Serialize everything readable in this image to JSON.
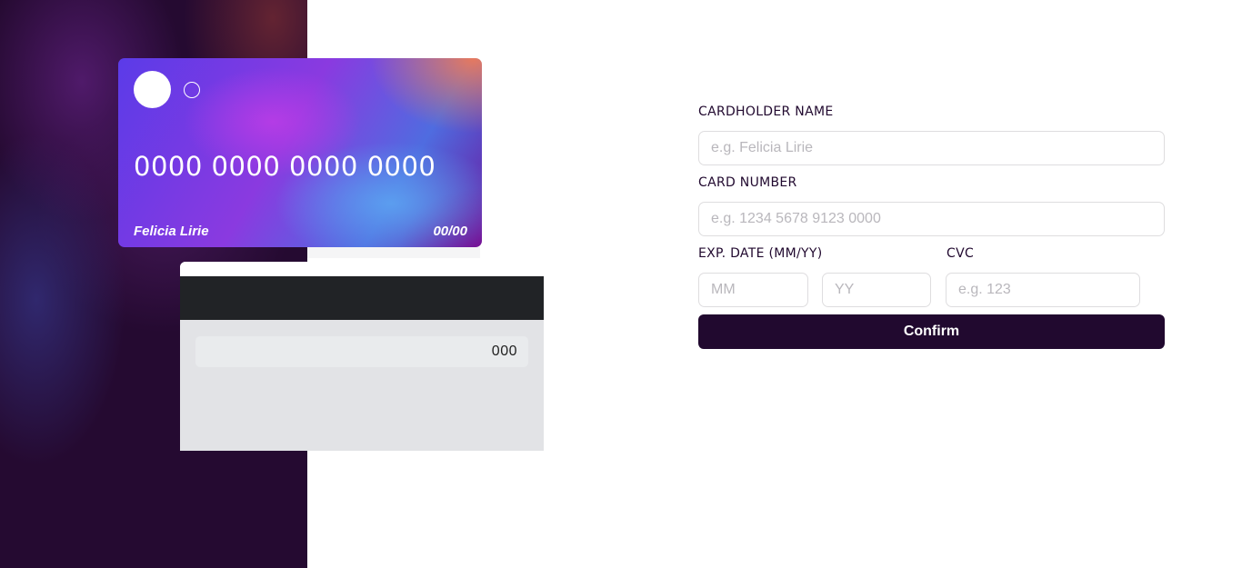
{
  "card_front": {
    "number": "0000 0000 0000 0000",
    "name": "Felicia Lirie",
    "expiry": "00/00"
  },
  "card_back": {
    "cvc": "000"
  },
  "form": {
    "cardholder_label": "CARDHOLDER NAME",
    "cardholder_placeholder": "e.g. Felicia Lirie",
    "number_label": "CARD NUMBER",
    "number_placeholder": "e.g. 1234 5678 9123 0000",
    "exp_label": "EXP. DATE (MM/YY)",
    "month_placeholder": "MM",
    "year_placeholder": "YY",
    "cvc_label": "CVC",
    "cvc_placeholder": "e.g. 123",
    "confirm_label": "Confirm"
  },
  "colors": {
    "dark_violet": "#21092f",
    "input_border": "#dedddf",
    "placeholder": "#b9b7bc"
  }
}
